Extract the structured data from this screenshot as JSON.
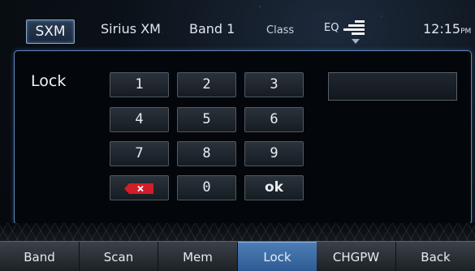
{
  "topbar": {
    "source_button": "SXM",
    "service": "Sirius XM",
    "band": "Band 1",
    "category": "Class",
    "eq_label": "EQ",
    "clock_time": "12:15",
    "clock_ampm": "PM",
    "eq_icon": "eq-bars-icon"
  },
  "lock_screen": {
    "title": "Lock",
    "keypad": {
      "key_1": "1",
      "key_2": "2",
      "key_3": "3",
      "key_4": "4",
      "key_5": "5",
      "key_6": "6",
      "key_7": "7",
      "key_8": "8",
      "key_9": "9",
      "key_0": "0",
      "ok": "ok",
      "delete_icon": "backspace-x-icon"
    },
    "pin_value": ""
  },
  "softkeys": [
    {
      "label": "Band"
    },
    {
      "label": "Scan"
    },
    {
      "label": "Mem"
    },
    {
      "label": "Lock",
      "active": true
    },
    {
      "label": "CHGPW"
    },
    {
      "label": "Back"
    }
  ],
  "colors": {
    "accent_active": "#3f6fa8",
    "panel_border": "#5f87b8",
    "delete_red": "#d21e2a"
  }
}
